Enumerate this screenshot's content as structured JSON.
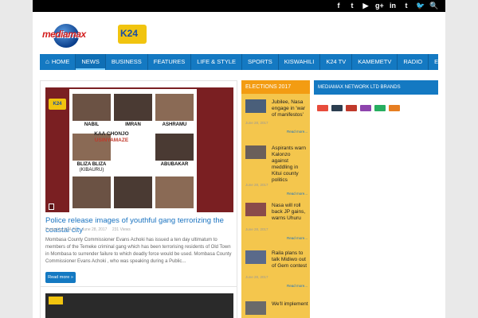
{
  "social": [
    "f",
    "t",
    "▶",
    "g+",
    "in",
    "t",
    "🐦",
    "🔍"
  ],
  "nav": [
    {
      "label": "HOME",
      "active": false
    },
    {
      "label": "NEWS",
      "active": true
    },
    {
      "label": "BUSINESS",
      "active": false
    },
    {
      "label": "FEATURES",
      "active": false
    },
    {
      "label": "LIFE & STYLE",
      "active": false
    },
    {
      "label": "SPORTS",
      "active": false
    },
    {
      "label": "KISWAHILI",
      "active": false
    },
    {
      "label": "K24 TV",
      "active": false
    },
    {
      "label": "KAMEMETV",
      "active": false
    },
    {
      "label": "RADIO",
      "active": false
    },
    {
      "label": "E-PAPER",
      "active": false
    }
  ],
  "logo": {
    "mediamax": "mediamax",
    "k24": "K24"
  },
  "photo": {
    "names": [
      "NABIL",
      "IMRAN",
      "ASHRAMU",
      "BLIZA BLIZA",
      "ABUBAKAR"
    ],
    "nickname_1": "(KIBAURU)",
    "headline_1": "KAA CHONJO",
    "headline_2": "USINYAMAZE",
    "watermark": "K24"
  },
  "main_article": {
    "title": "Police release images of youthful gang terrorizing the coastal city",
    "meta": {
      "author": "Posted by K24 Tv",
      "date": "June 28, 2017",
      "views": "231 Views"
    },
    "excerpt": "Mombasa County Commissioner Evans Achoki has issued a ten day ultimatum to members of the Temeke criminal gang which has been terrorising residents of Old Town in Mombasa to surrender failure to which deadly force would be used. Mombasa County Commissioner Evans Achoki , who was speaking during a Public...",
    "read_more": "Read more »"
  },
  "elections": {
    "heading": "ELECTIONS 2017",
    "items": [
      {
        "title": "Jubilee, Nasa engage in 'war of manifestos'",
        "date": "June 28, 2017",
        "more": "Read more..."
      },
      {
        "title": "Aspirants warn Kalonzo against meddling in Kitui county politics",
        "date": "June 28, 2017",
        "more": "Read more..."
      },
      {
        "title": "Nasa will roll back JP gains, warns Uhuru",
        "date": "June 28, 2017",
        "more": "Read more..."
      },
      {
        "title": "Raila plans to talk Midiwo out of Gem contest",
        "date": "June 28, 2017",
        "more": "Read more..."
      },
      {
        "title": "We'll implement",
        "date": "",
        "more": ""
      }
    ]
  },
  "brands": {
    "heading": "MEDIAMAX NETWORK LTD BRANDS",
    "colors": [
      "#e74c3c",
      "#2c3e50",
      "#c0392b",
      "#8e44ad",
      "#27ae60",
      "#e67e22"
    ]
  },
  "colors": {
    "nav": "#1479c2",
    "elections": "#f39c12",
    "link": "#1a73c0"
  }
}
